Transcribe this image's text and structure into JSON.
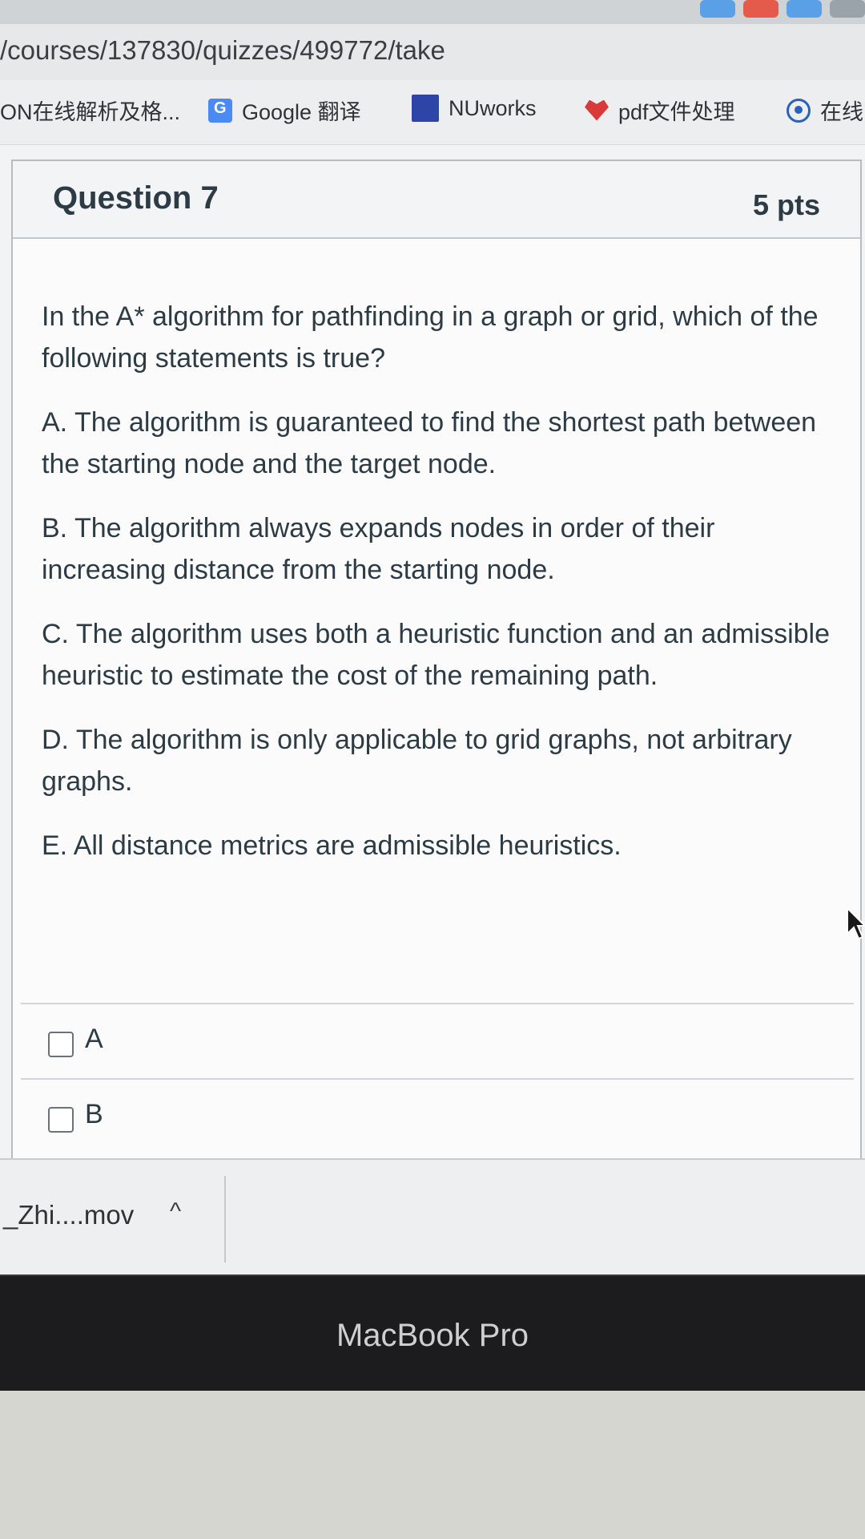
{
  "browser": {
    "url": "/courses/137830/quizzes/499772/take"
  },
  "bookmarks": [
    {
      "label": "ON在线解析及格...",
      "icon": "bookmark-icon"
    },
    {
      "label": "Google 翻译",
      "icon": "google-translate-icon"
    },
    {
      "label": "NUworks",
      "icon": "nuworks-icon"
    },
    {
      "label": "pdf文件处理",
      "icon": "heart-icon"
    },
    {
      "label": "在线",
      "icon": "circle-icon"
    }
  ],
  "question": {
    "title": "Question 7",
    "points": "5 pts",
    "prompt": "In the A* algorithm for pathfinding in a graph or grid, which of the following statements is true?",
    "options": [
      "A. The algorithm is guaranteed to find the shortest path between the starting node and the target node.",
      "B. The algorithm always expands nodes in order of their increasing distance from the starting node.",
      "C. The algorithm uses both a heuristic function and an admissible heuristic to estimate the cost of the remaining path.",
      "D. The algorithm is only applicable to grid graphs, not arbitrary graphs.",
      "E. All distance metrics are admissible heuristics."
    ]
  },
  "answers": [
    {
      "label": "A",
      "checked": false
    },
    {
      "label": "B",
      "checked": false
    }
  ],
  "downloads": {
    "file_name": "_Zhi....mov",
    "chevron": "^"
  },
  "device": {
    "label": "MacBook Pro"
  }
}
